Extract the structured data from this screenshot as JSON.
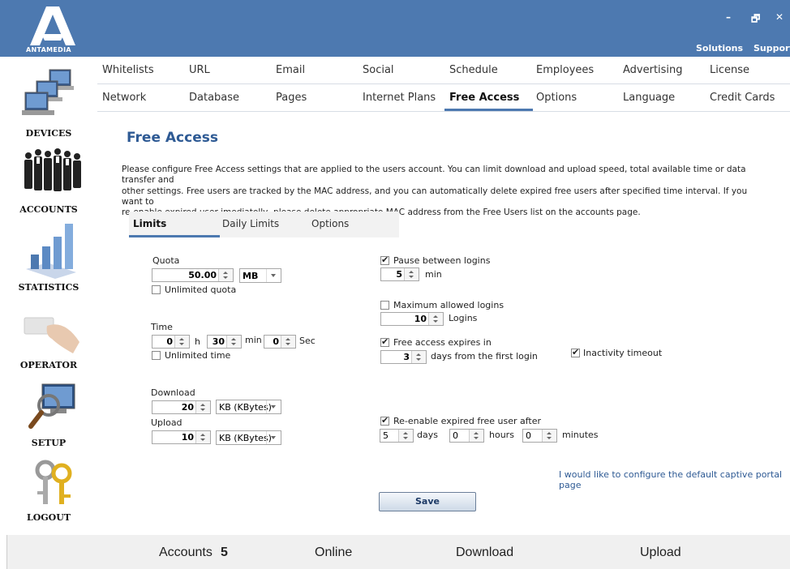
{
  "brand": {
    "name": "ANTAMEDIA"
  },
  "window": {
    "minimize": "–",
    "restore": "🗗",
    "close": "✕"
  },
  "topnav": {
    "solutions": "Solutions",
    "support": "Support"
  },
  "sidebar": [
    {
      "label": "DEVICES",
      "icon": "devices-icon"
    },
    {
      "label": "ACCOUNTS",
      "icon": "accounts-icon"
    },
    {
      "label": "STATISTICS",
      "icon": "statistics-icon"
    },
    {
      "label": "OPERATOR",
      "icon": "operator-icon"
    },
    {
      "label": "SETUP",
      "icon": "setup-icon"
    },
    {
      "label": "LOGOUT",
      "icon": "logout-icon"
    }
  ],
  "tabs_row1": [
    "Whitelists",
    "URL",
    "Email",
    "Social",
    "Schedule",
    "Employees",
    "Advertising",
    "License"
  ],
  "tabs_row2": [
    "Network",
    "Database",
    "Pages",
    "Internet Plans",
    "Free Access",
    "Options",
    "Language",
    "Credit Cards"
  ],
  "active_tab": "Free Access",
  "page": {
    "title": "Free Access",
    "description": [
      "Please configure Free Access settings that are applied to the users account. You can limit download and upload speed, total available time or data transfer and",
      "other settings. Free users are tracked by the MAC address, and you can automatically delete expired free users after specified time interval. If you want to",
      "re-enable expired user imediatelly, please delete appropriate MAC address from the Free Users list on the accounts page."
    ]
  },
  "subtabs": [
    "Limits",
    "Daily Limits",
    "Options"
  ],
  "form": {
    "quota_label": "Quota",
    "quota_value": "50.00",
    "quota_unit": "MB",
    "unlimited_quota": "Unlimited quota",
    "time_label": "Time",
    "time_h": "0",
    "time_h_unit": "h",
    "time_min": "30",
    "time_min_unit": "min",
    "time_sec": "0",
    "time_sec_unit": "Sec",
    "unlimited_time": "Unlimited time",
    "download_label": "Download",
    "download_value": "20",
    "download_unit": "KB (KBytes)",
    "upload_label": "Upload",
    "upload_value": "10",
    "upload_unit": "KB (KBytes)",
    "pause_label": "Pause between logins",
    "pause_value": "5",
    "pause_unit": "min",
    "max_logins_label": "Maximum allowed logins",
    "max_logins_value": "10",
    "max_logins_unit": "Logins",
    "expires_label": "Free access expires in",
    "expires_value": "3",
    "expires_unit": "days from the first login",
    "inactivity_label": "Inactivity timeout",
    "reenable_label": "Re-enable expired free user after",
    "reenable_days": "5",
    "reenable_days_unit": "days",
    "reenable_hours": "0",
    "reenable_hours_unit": "hours",
    "reenable_minutes": "0",
    "reenable_minutes_unit": "minutes",
    "portal_link": "I would like to configure the default captive portal page",
    "save": "Save"
  },
  "checks": {
    "unlimited_quota": false,
    "unlimited_time": false,
    "pause": true,
    "max_logins": false,
    "expires": true,
    "inactivity": true,
    "reenable": true
  },
  "footer": {
    "accounts_label": "Accounts",
    "accounts_value": "5",
    "online_label": "Online",
    "download_label": "Download",
    "upload_label": "Upload"
  },
  "colors": {
    "header": "#4d79b0",
    "accent": "#2e5a94",
    "active_underline": "#4d79b0"
  }
}
